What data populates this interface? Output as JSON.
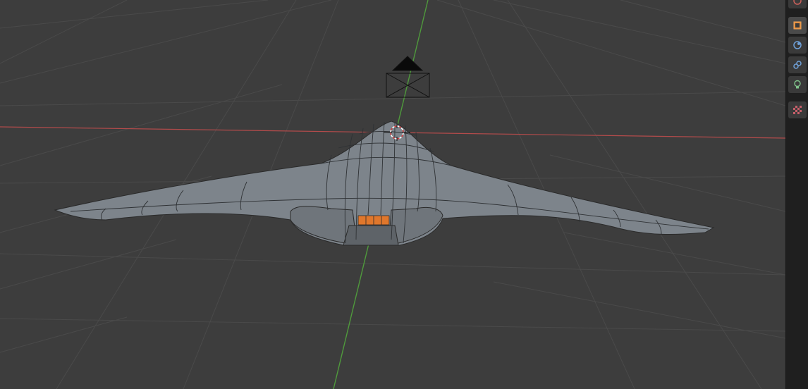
{
  "app": {
    "name": "3D Viewport",
    "colors": {
      "viewport_bg": "#3d3d3d",
      "grid_line": "#4a4a4a",
      "x_axis": "#b34b4b",
      "y_axis": "#4f9a3c",
      "mesh_fill": "#7d848b",
      "mesh_edge": "#2a2a2a",
      "selected_face": "#e0772c",
      "strip_bg": "#1f1f1f"
    }
  },
  "scene": {
    "objects": [
      "camera",
      "aircraft-mesh",
      "3d-cursor"
    ]
  },
  "properties_tabs": [
    {
      "id": "scene",
      "icon": "scene-icon",
      "active": false
    },
    {
      "id": "object",
      "icon": "object-cube-icon",
      "active": true
    },
    {
      "id": "physics",
      "icon": "physics-icon",
      "active": false
    },
    {
      "id": "constraints",
      "icon": "constraint-icon",
      "active": false
    },
    {
      "id": "object-data",
      "icon": "lightbulb-icon",
      "active": false
    },
    {
      "id": "texture",
      "icon": "texture-checker-icon",
      "active": false
    }
  ]
}
